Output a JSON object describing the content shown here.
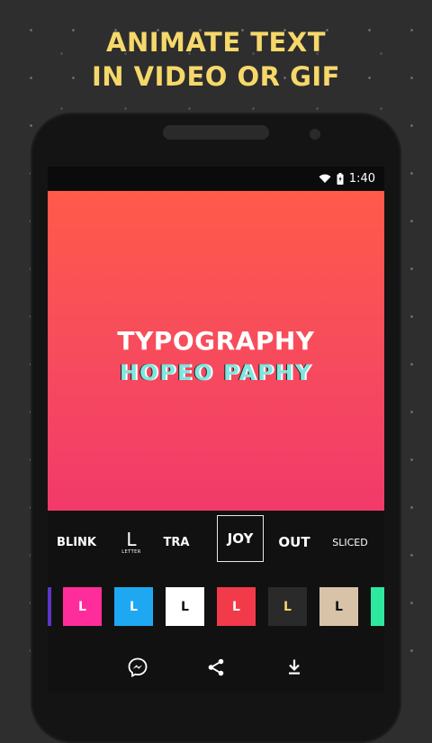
{
  "headline": {
    "line1": "ANIMATE TEXT",
    "line2": "IN VIDEO OR GIF",
    "color": "#f6d86a"
  },
  "status_bar": {
    "time": "1:40",
    "icons": [
      "wifi-icon",
      "battery-icon"
    ]
  },
  "canvas": {
    "title_line1": "TYPOGRAPHY",
    "title_line2": "HOPEO PAPHY",
    "gradient": [
      "#ff5a4a",
      "#f23a6a"
    ]
  },
  "effects": [
    {
      "label": "BLINK"
    },
    {
      "label": "L",
      "sub": "LETTER"
    },
    {
      "label": "TRA"
    },
    {
      "label": "JOY",
      "selected": true
    },
    {
      "label": "OUT"
    },
    {
      "label": "SLICED"
    }
  ],
  "swatches": [
    {
      "label": "",
      "bg": "#5d35c9",
      "fg": "#ffffff"
    },
    {
      "label": "L",
      "bg": "#ff2c9b",
      "fg": "#ffffff"
    },
    {
      "label": "L",
      "bg": "#1ea8f2",
      "fg": "#ffffff"
    },
    {
      "label": "L",
      "bg": "#ffffff",
      "fg": "#111111"
    },
    {
      "label": "L",
      "bg": "#f23a4a",
      "fg": "#ffffff"
    },
    {
      "label": "L",
      "bg": "#2a2a2a",
      "fg": "#f4d66a"
    },
    {
      "label": "L",
      "bg": "#d8c2a8",
      "fg": "#111111"
    },
    {
      "label": "",
      "bg": "#2fe8a0",
      "fg": "#111111"
    }
  ],
  "actions": [
    "messenger-icon",
    "share-icon",
    "download-icon"
  ]
}
